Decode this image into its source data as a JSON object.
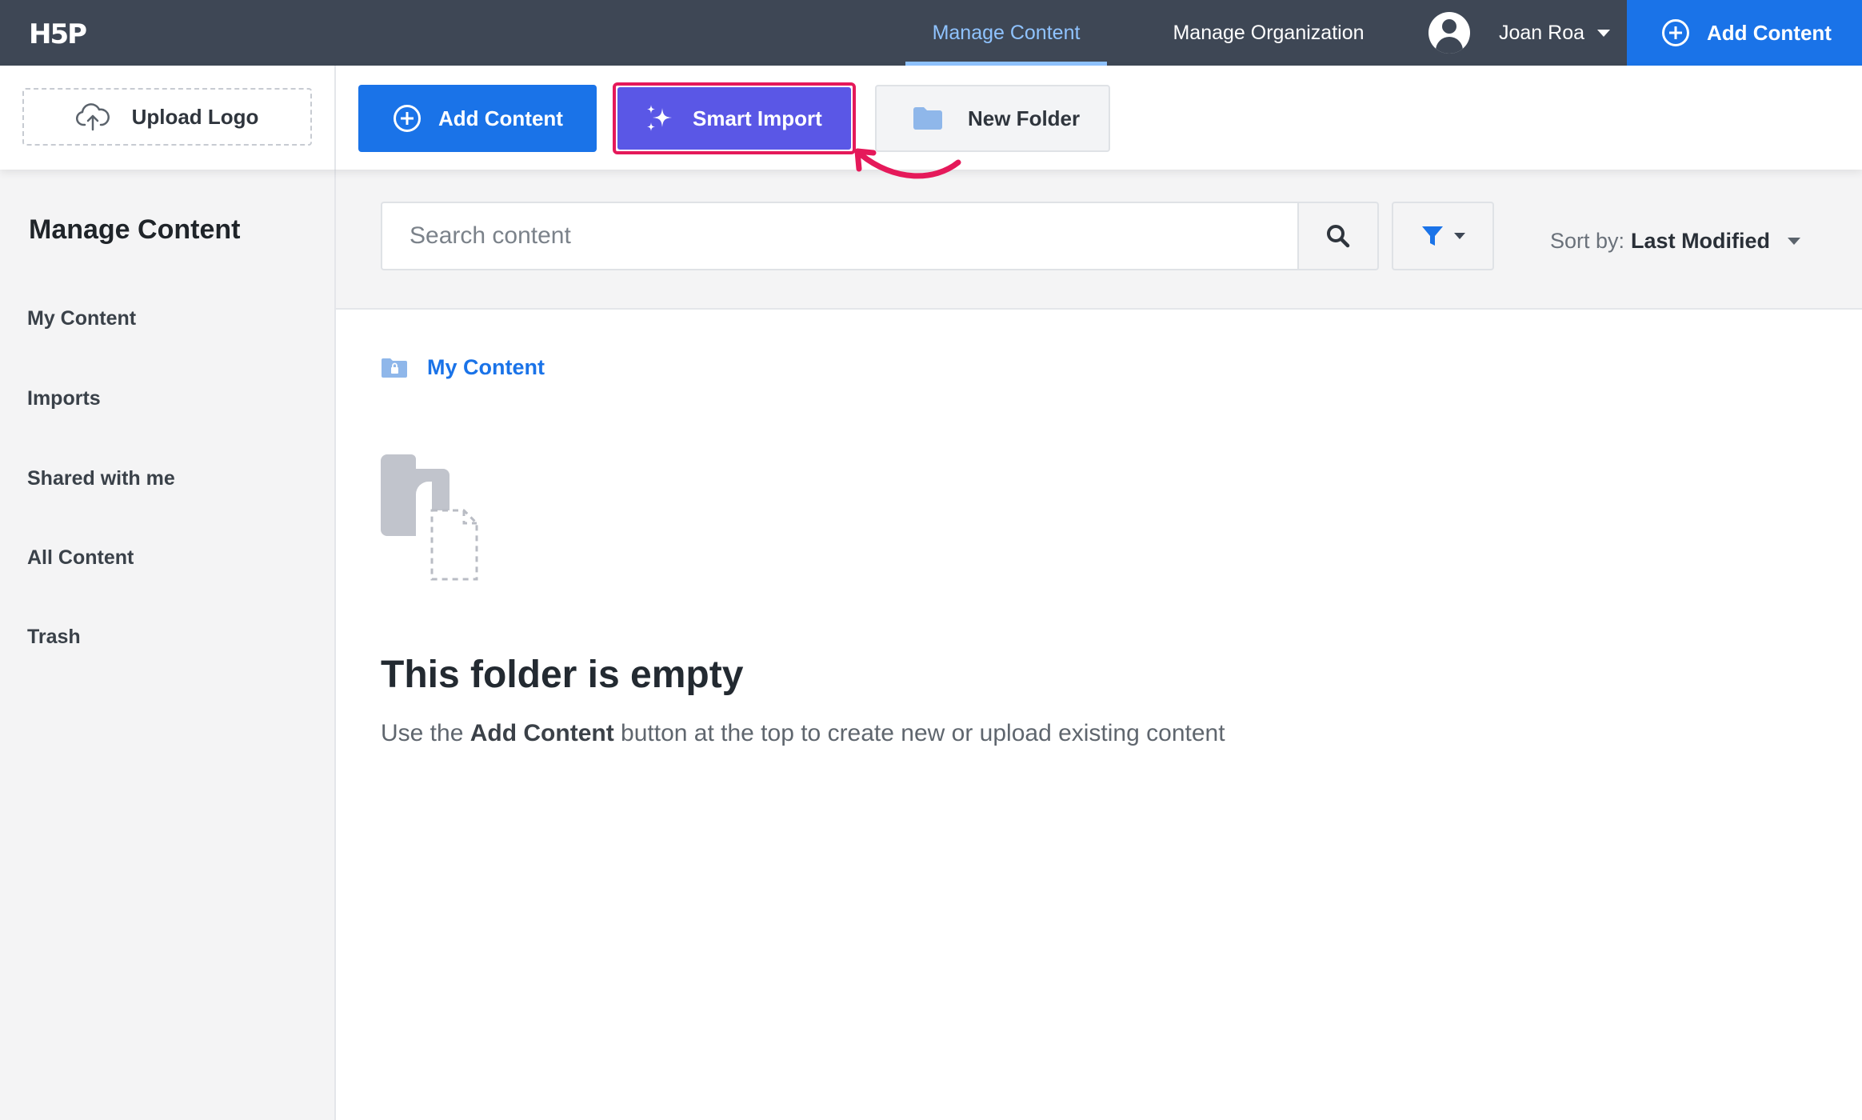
{
  "topbar": {
    "logo_text": "H5P",
    "tabs": [
      {
        "label": "Manage Content",
        "active": true
      },
      {
        "label": "Manage Organization",
        "active": false
      }
    ],
    "user_name": "Joan Roa",
    "add_content_label": "Add Content"
  },
  "toolbar": {
    "upload_logo_label": "Upload Logo",
    "add_content_label": "Add Content",
    "smart_import_label": "Smart Import",
    "new_folder_label": "New Folder"
  },
  "sidebar": {
    "title": "Manage Content",
    "items": [
      {
        "label": "My Content"
      },
      {
        "label": "Imports"
      },
      {
        "label": "Shared with me"
      },
      {
        "label": "All Content"
      },
      {
        "label": "Trash"
      }
    ]
  },
  "search": {
    "placeholder": "Search content",
    "sort_prefix": "Sort by:",
    "sort_value": "Last Modified"
  },
  "main": {
    "breadcrumb": "My Content",
    "empty_title": "This folder is empty",
    "empty_desc_before": "Use the ",
    "empty_desc_strong": "Add Content",
    "empty_desc_after": " button at the top to create new or upload existing content"
  },
  "colors": {
    "topbar_bg": "#3e4755",
    "accent_blue": "#1a73e8",
    "smart_import_purple": "#5a57e6",
    "highlight_pink": "#e5195a",
    "active_tab": "#8fc3ff"
  },
  "icons": [
    "cloud-upload-icon",
    "plus-circle-icon",
    "sparkle-icon",
    "folder-icon",
    "search-icon",
    "filter-icon",
    "user-avatar-icon",
    "caret-down-icon",
    "folder-lock-icon",
    "empty-folder-icon"
  ]
}
